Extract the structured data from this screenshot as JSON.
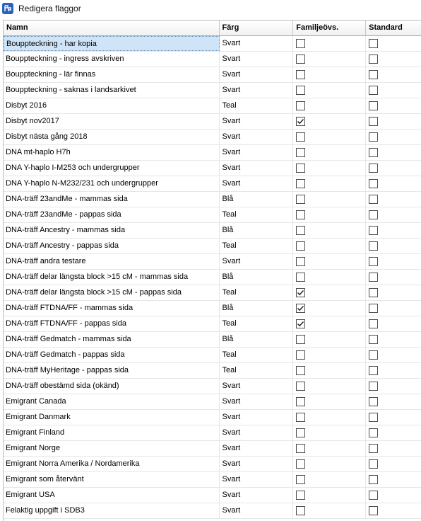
{
  "window": {
    "title": "Redigera flaggor"
  },
  "columns": {
    "name": "Namn",
    "color": "Färg",
    "family": "Familjeövs.",
    "standard": "Standard"
  },
  "rows": [
    {
      "name": "Bouppteckning - har kopia",
      "color": "Svart",
      "family": false,
      "standard": false,
      "selected": true
    },
    {
      "name": "Bouppteckning - ingress avskriven",
      "color": "Svart",
      "family": false,
      "standard": false
    },
    {
      "name": "Bouppteckning - lär finnas",
      "color": "Svart",
      "family": false,
      "standard": false
    },
    {
      "name": "Bouppteckning - saknas i landsarkivet",
      "color": "Svart",
      "family": false,
      "standard": false
    },
    {
      "name": "Disbyt 2016",
      "color": "Teal",
      "family": false,
      "standard": false
    },
    {
      "name": "Disbyt nov2017",
      "color": "Svart",
      "family": true,
      "standard": false
    },
    {
      "name": "Disbyt nästa gång 2018",
      "color": "Svart",
      "family": false,
      "standard": false
    },
    {
      "name": "DNA mt-haplo H7h",
      "color": "Svart",
      "family": false,
      "standard": false
    },
    {
      "name": "DNA Y-haplo I-M253 och undergrupper",
      "color": "Svart",
      "family": false,
      "standard": false
    },
    {
      "name": "DNA Y-haplo N-M232/231 och undergrupper",
      "color": "Svart",
      "family": false,
      "standard": false
    },
    {
      "name": "DNA-träff 23andMe - mammas sida",
      "color": "Blå",
      "family": false,
      "standard": false
    },
    {
      "name": "DNA-träff 23andMe - pappas sida",
      "color": "Teal",
      "family": false,
      "standard": false
    },
    {
      "name": "DNA-träff Ancestry - mammas sida",
      "color": "Blå",
      "family": false,
      "standard": false
    },
    {
      "name": "DNA-träff Ancestry - pappas sida",
      "color": "Teal",
      "family": false,
      "standard": false
    },
    {
      "name": "DNA-träff andra testare",
      "color": "Svart",
      "family": false,
      "standard": false
    },
    {
      "name": "DNA-träff delar längsta block >15 cM - mammas sida",
      "color": "Blå",
      "family": false,
      "standard": false
    },
    {
      "name": "DNA-träff delar längsta block >15 cM - pappas sida",
      "color": "Teal",
      "family": true,
      "standard": false
    },
    {
      "name": "DNA-träff FTDNA/FF - mammas sida",
      "color": "Blå",
      "family": true,
      "standard": false
    },
    {
      "name": "DNA-träff FTDNA/FF - pappas sida",
      "color": "Teal",
      "family": true,
      "standard": false
    },
    {
      "name": "DNA-träff Gedmatch - mammas sida",
      "color": "Blå",
      "family": false,
      "standard": false
    },
    {
      "name": "DNA-träff Gedmatch - pappas sida",
      "color": "Teal",
      "family": false,
      "standard": false
    },
    {
      "name": "DNA-träff MyHeritage - pappas sida",
      "color": "Teal",
      "family": false,
      "standard": false
    },
    {
      "name": "DNA-träff obestämd sida (okänd)",
      "color": "Svart",
      "family": false,
      "standard": false
    },
    {
      "name": "Emigrant Canada",
      "color": "Svart",
      "family": false,
      "standard": false
    },
    {
      "name": "Emigrant Danmark",
      "color": "Svart",
      "family": false,
      "standard": false
    },
    {
      "name": "Emigrant Finland",
      "color": "Svart",
      "family": false,
      "standard": false
    },
    {
      "name": "Emigrant Norge",
      "color": "Svart",
      "family": false,
      "standard": false
    },
    {
      "name": "Emigrant Norra Amerika / Nordamerika",
      "color": "Svart",
      "family": false,
      "standard": false
    },
    {
      "name": "Emigrant som återvänt",
      "color": "Svart",
      "family": false,
      "standard": false
    },
    {
      "name": "Emigrant USA",
      "color": "Svart",
      "family": false,
      "standard": false
    },
    {
      "name": "Felaktig uppgift i SDB3",
      "color": "Svart",
      "family": false,
      "standard": false
    }
  ],
  "theme": {
    "selection": "#cfe4f7",
    "icon_bg": "#2a63b8"
  }
}
